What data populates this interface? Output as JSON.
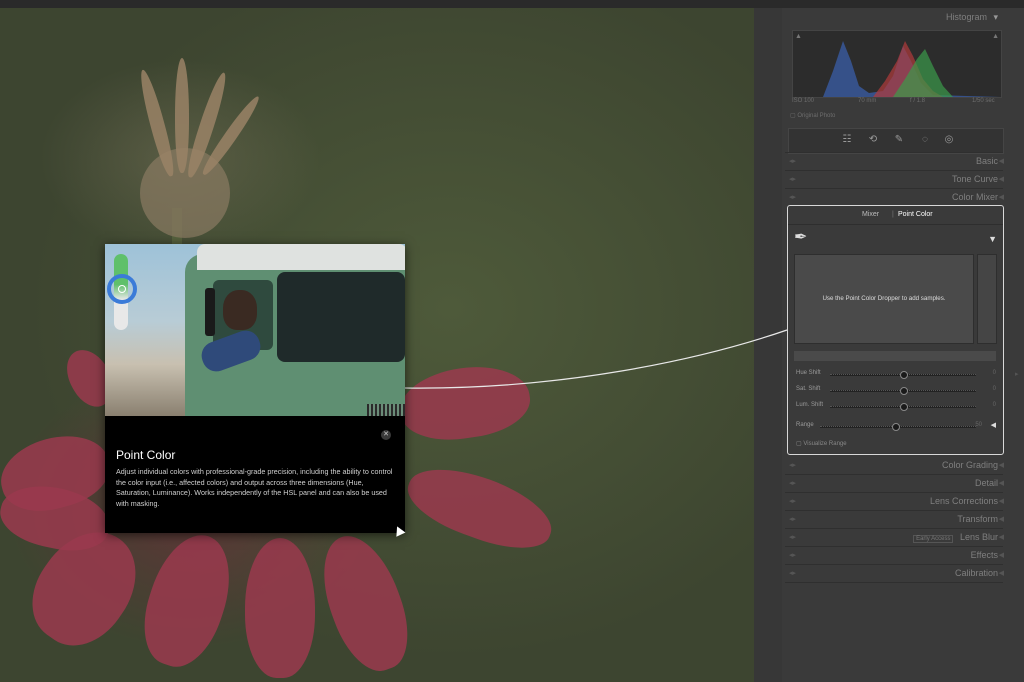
{
  "panel": {
    "histogram_label": "Histogram",
    "histogram_meta": {
      "iso": "ISO 100",
      "focal": "70 mm",
      "aperture": "f / 1.8",
      "shutter": "1/50 sec"
    },
    "original_photo_label": "Original Photo",
    "sections": [
      {
        "label": "Basic"
      },
      {
        "label": "Tone Curve"
      },
      {
        "label": "Color Mixer"
      }
    ],
    "sections_below": [
      {
        "label": "Color Grading"
      },
      {
        "label": "Detail"
      },
      {
        "label": "Lens Corrections"
      },
      {
        "label": "Transform"
      },
      {
        "label": "Lens Blur",
        "badge": "Early Access"
      },
      {
        "label": "Effects"
      },
      {
        "label": "Calibration"
      }
    ]
  },
  "point_color": {
    "tabs": [
      "Mixer",
      "Point Color"
    ],
    "active_tab": "Point Color",
    "dropper_hint": "Use the Point Color Dropper to add samples.",
    "sliders": [
      {
        "label": "Hue Shift",
        "value": "0",
        "position": 0.5
      },
      {
        "label": "Sat. Shift",
        "value": "0",
        "position": 0.5
      },
      {
        "label": "Lum. Shift",
        "value": "0",
        "position": 0.5
      }
    ],
    "range": {
      "label": "Range",
      "value": "50",
      "position": 0.5
    },
    "visualize_label": "Visualize Range"
  },
  "popup": {
    "title": "Point Color",
    "description": "Adjust individual colors with professional-grade precision, including the ability to control the color input (i.e., affected colors) and output across three dimensions (Hue, Saturation, Luminance). Works independently of the HSL panel and can also be used with masking.",
    "close_symbol": "✕"
  },
  "colors": {
    "highlight_border": "#d8d8d8",
    "selector_ring": "#3b7bd8",
    "panel_bg": "#3a3a3a"
  }
}
